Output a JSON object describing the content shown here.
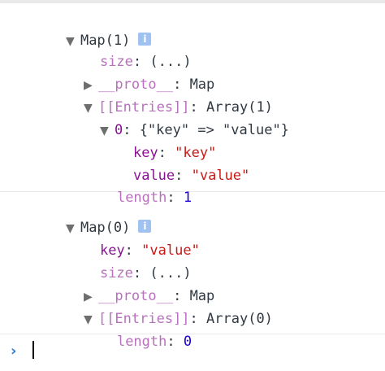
{
  "messages": [
    {
      "header": "Map(1)",
      "info_glyph": "i",
      "rows": {
        "size_key": "size",
        "size_value": "(...)",
        "proto_key": "__proto__",
        "proto_value": "Map",
        "entries_key": "[[Entries]]",
        "entries_value": "Array(1)",
        "entry0_key": "0",
        "entry0_value": "{\"key\" => \"value\"}",
        "key_key": "key",
        "key_value": "\"key\"",
        "value_key": "value",
        "value_value": "\"value\"",
        "length_key": "length",
        "length_value": "1"
      }
    },
    {
      "header": "Map(0)",
      "info_glyph": "i",
      "rows": {
        "key_key": "key",
        "key_value": "\"value\"",
        "size_key": "size",
        "size_value": "(...)",
        "proto_key": "__proto__",
        "proto_value": "Map",
        "entries_key": "[[Entries]]",
        "entries_value": "Array(0)",
        "length_key": "length",
        "length_value": "0"
      }
    }
  ],
  "icons": {
    "expanded": "▼",
    "collapsed": "▶",
    "prompt": "›"
  },
  "colors": {
    "property_name": "#881391",
    "property_dimmed": "#b871bd",
    "string": "#c41a16",
    "number": "#1c00cf",
    "text": "#303942",
    "info_badge": "#9fc2f0",
    "prompt": "#2f7fd6"
  }
}
